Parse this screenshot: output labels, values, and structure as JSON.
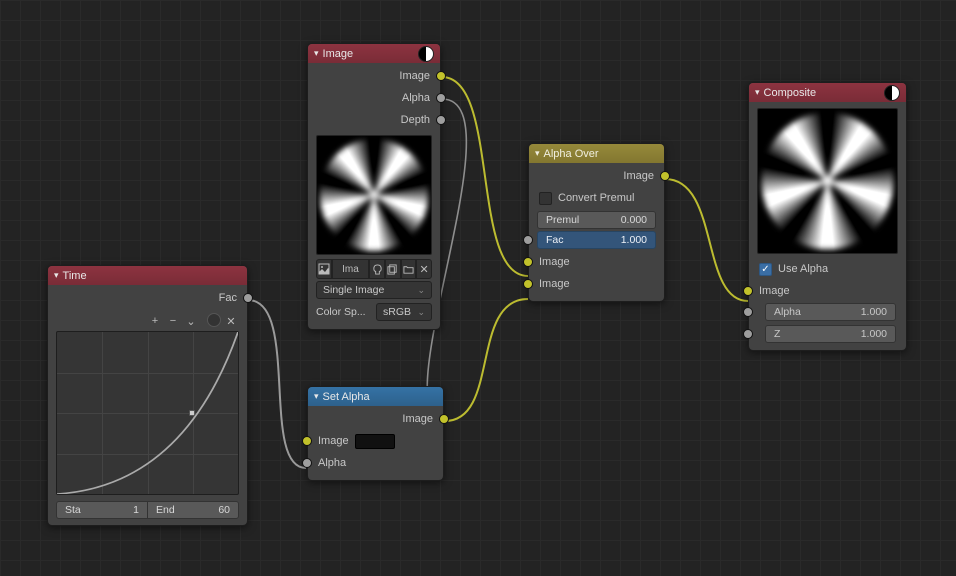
{
  "nodes": {
    "time": {
      "title": "Time",
      "outputs": {
        "fac": "Fac"
      },
      "toolbar": {
        "zoom_in": "+",
        "zoom_out": "−",
        "tools": "⌄",
        "clip": "●",
        "reset": "✕"
      },
      "sta_label": "Sta",
      "sta_val": "1",
      "end_label": "End",
      "end_val": "60"
    },
    "image": {
      "title": "Image",
      "outputs": {
        "image": "Image",
        "alpha": "Alpha",
        "depth": "Depth"
      },
      "imgname": "Ima",
      "source_label": "Single Image",
      "colorspace_label": "Color Sp...",
      "colorspace_val": "sRGB"
    },
    "setalpha": {
      "title": "Set Alpha",
      "outputs": {
        "image": "Image"
      },
      "inputs": {
        "image": "Image",
        "alpha": "Alpha"
      }
    },
    "alphaover": {
      "title": "Alpha Over",
      "outputs": {
        "image": "Image"
      },
      "convert": "Convert Premul",
      "premul_label": "Premul",
      "premul_val": "0.000",
      "fac_label": "Fac",
      "fac_val": "1.000",
      "inputs": {
        "image1": "Image",
        "image2": "Image"
      }
    },
    "composite": {
      "title": "Composite",
      "use_alpha": "Use Alpha",
      "inputs": {
        "image": "Image",
        "alpha_label": "Alpha",
        "alpha_val": "1.000",
        "z_label": "Z",
        "z_val": "1.000"
      }
    }
  }
}
